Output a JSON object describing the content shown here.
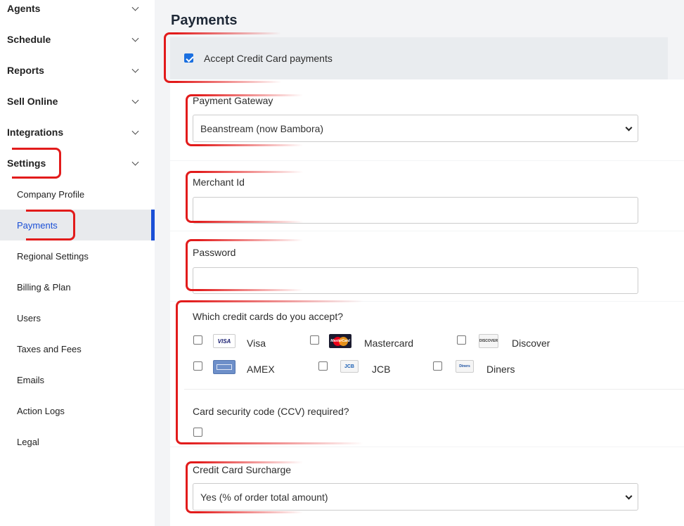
{
  "sidebar": {
    "sections": [
      {
        "label": "Agents"
      },
      {
        "label": "Schedule"
      },
      {
        "label": "Reports"
      },
      {
        "label": "Sell Online"
      },
      {
        "label": "Integrations"
      },
      {
        "label": "Settings"
      }
    ],
    "settings_items": [
      {
        "label": "Company Profile"
      },
      {
        "label": "Payments"
      },
      {
        "label": "Regional Settings"
      },
      {
        "label": "Billing & Plan"
      },
      {
        "label": "Users"
      },
      {
        "label": "Taxes and Fees"
      },
      {
        "label": "Emails"
      },
      {
        "label": "Action Logs"
      },
      {
        "label": "Legal"
      }
    ],
    "active_item": "Payments"
  },
  "main": {
    "title": "Payments",
    "accept_credit_card": {
      "label": "Accept Credit Card payments",
      "checked": true
    },
    "payment_gateway": {
      "label": "Payment Gateway",
      "value": "Beanstream (now Bambora)"
    },
    "merchant_id": {
      "label": "Merchant Id",
      "value": ""
    },
    "password": {
      "label": "Password",
      "value": ""
    },
    "credit_cards": {
      "question": "Which credit cards do you accept?",
      "cards": [
        {
          "name": "Visa",
          "logo_text": "VISA",
          "checked": false
        },
        {
          "name": "Mastercard",
          "logo_text": "MasterCard",
          "checked": false
        },
        {
          "name": "Discover",
          "logo_text": "DISCOVER",
          "checked": false
        },
        {
          "name": "AMEX",
          "logo_text": "",
          "checked": false
        },
        {
          "name": "JCB",
          "logo_text": "JCB",
          "checked": false
        },
        {
          "name": "Diners",
          "logo_text": "Diners",
          "checked": false
        }
      ]
    },
    "ccv": {
      "label": "Card security code (CCV) required?",
      "checked": false
    },
    "surcharge": {
      "label": "Credit Card Surcharge",
      "value": "Yes (% of order total amount)"
    }
  },
  "colors": {
    "accent": "#1a4fd6",
    "highlight": "#e21b1b",
    "checkbox_checked": "#1a6fe0"
  }
}
